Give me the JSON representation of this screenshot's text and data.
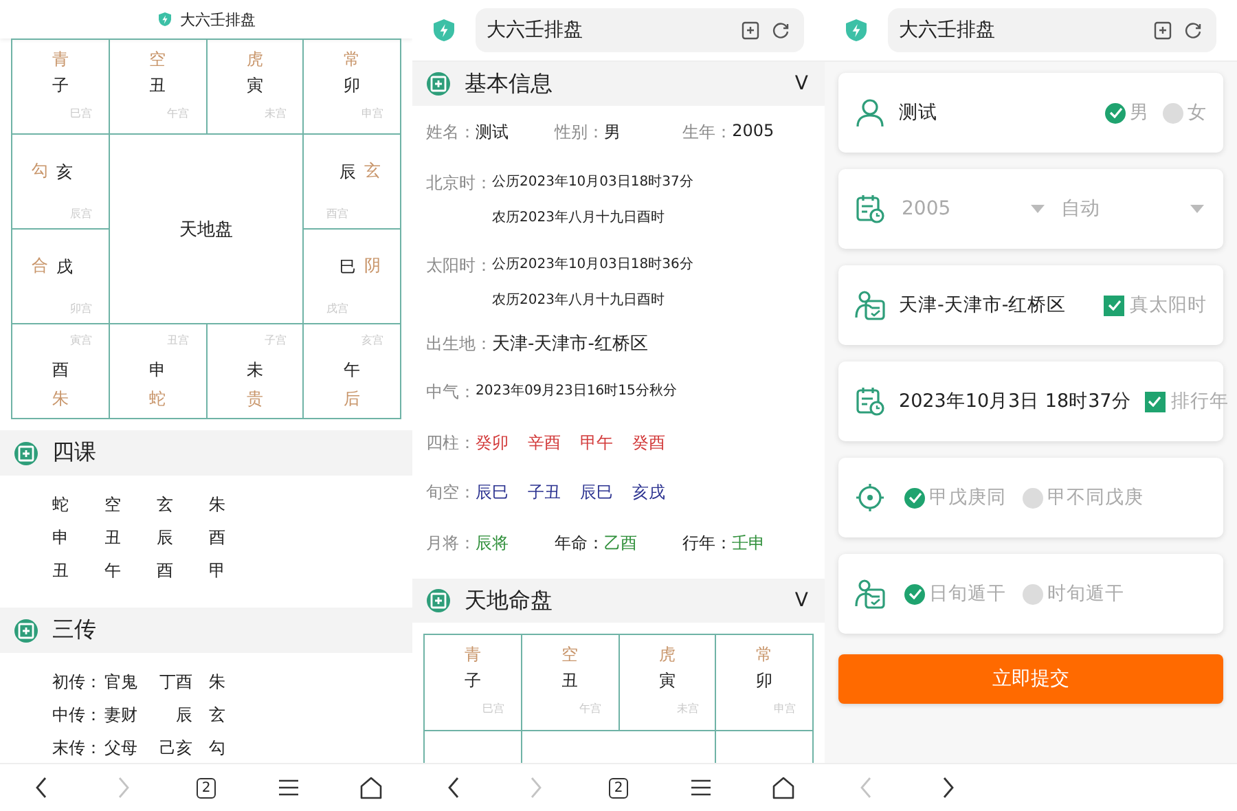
{
  "chart_screen": {
    "title": "大六壬排盘",
    "board": {
      "center": "天地盘",
      "cells": [
        {
          "god": "青",
          "branch": "子",
          "palace": "巳宫"
        },
        {
          "god": "空",
          "branch": "丑",
          "palace": "午宫"
        },
        {
          "god": "虎",
          "branch": "寅",
          "palace": "未宫"
        },
        {
          "god": "常",
          "branch": "卯",
          "palace": "申宫"
        },
        {
          "god": "勾",
          "branch": "亥",
          "palace": "辰宫"
        },
        {
          "god": "玄",
          "branch": "辰",
          "palace": "酉宫"
        },
        {
          "god": "合",
          "branch": "戌",
          "palace": "卯宫"
        },
        {
          "god": "阴",
          "branch": "巳",
          "palace": "戌宫"
        },
        {
          "god": "朱",
          "branch": "酉",
          "palace": "寅宫"
        },
        {
          "god": "蛇",
          "branch": "申",
          "palace": "丑宫"
        },
        {
          "god": "贵",
          "branch": "未",
          "palace": "子宫"
        },
        {
          "god": "后",
          "branch": "午",
          "palace": "亥宫"
        }
      ]
    },
    "lessons": {
      "title": "四课",
      "rows": [
        [
          "蛇",
          "空",
          "玄",
          "朱"
        ],
        [
          "申",
          "丑",
          "辰",
          "酉"
        ],
        [
          "丑",
          "午",
          "酉",
          "甲"
        ]
      ]
    },
    "transmissions": {
      "title": "三传",
      "rows": [
        {
          "label": "初传：",
          "relation": "官鬼",
          "stem_branch": "丁酉",
          "god": "朱"
        },
        {
          "label": "中传：",
          "relation": "妻财",
          "stem_branch": "辰",
          "god": "玄"
        },
        {
          "label": "末传：",
          "relation": "父母",
          "stem_branch": "己亥",
          "god": "勾"
        }
      ]
    },
    "nav": [
      {
        "kind": "back",
        "disabled": false
      },
      {
        "kind": "forward",
        "disabled": true
      },
      {
        "kind": "tabs",
        "label": "2"
      },
      {
        "kind": "menu"
      },
      {
        "kind": "home"
      }
    ]
  },
  "info_screen": {
    "address": "大六壬排盘",
    "basic": {
      "title": "基本信息",
      "toggle": "V",
      "rows": [
        {
          "kind": "fields",
          "fields": [
            {
              "label": "姓名：",
              "value": "测试",
              "strong": false
            },
            {
              "label": "性别：",
              "value": "男",
              "strong": false
            },
            {
              "label": "生年：",
              "value": "2005",
              "strong": false
            }
          ]
        },
        {
          "kind": "lines",
          "label": "北京时：",
          "lines": [
            "公历2023年10月03日18时37分",
            "农历2023年八月十九日酉时"
          ]
        },
        {
          "kind": "lines",
          "label": "太阳时：",
          "lines": [
            "公历2023年10月03日18时36分",
            "农历2023年八月十九日酉时"
          ]
        },
        {
          "kind": "place",
          "label": "出生地：",
          "value": "天津-天津市-红桥区"
        },
        {
          "kind": "lines",
          "label": "中气：",
          "lines": [
            "2023年09月23日16时15分秋分"
          ]
        },
        {
          "kind": "values",
          "label": "四柱：",
          "color": "#d23a3a",
          "values": [
            "癸卯",
            "辛酉",
            "甲午",
            "癸酉"
          ]
        },
        {
          "kind": "values",
          "label": "旬空：",
          "color": "#2b3290",
          "values": [
            "辰巳",
            "子丑",
            "辰巳",
            "亥戌"
          ]
        },
        {
          "kind": "fields",
          "fields": [
            {
              "label": "月将：",
              "value": "辰将",
              "strong": false,
              "color": "#2f8f3a"
            },
            {
              "label": "年命：",
              "value": "乙酉",
              "strong": true,
              "color": "#2f8f3a"
            },
            {
              "label": "行年：",
              "value": "壬申",
              "strong": true,
              "color": "#2f8f3a"
            }
          ]
        }
      ]
    },
    "chart": {
      "title": "天地命盘",
      "toggle": "V",
      "cells": [
        {
          "god": "青",
          "branch": "子",
          "palace": "巳宫"
        },
        {
          "god": "空",
          "branch": "丑",
          "palace": "午宫"
        },
        {
          "god": "虎",
          "branch": "寅",
          "palace": "未宫"
        },
        {
          "god": "常",
          "branch": "卯",
          "palace": "申宫"
        }
      ]
    },
    "nav": [
      {
        "kind": "back",
        "disabled": false
      },
      {
        "kind": "forward",
        "disabled": true
      },
      {
        "kind": "tabs",
        "label": "2"
      },
      {
        "kind": "menu"
      },
      {
        "kind": "home"
      }
    ]
  },
  "form_screen": {
    "address": "大六壬排盘",
    "cards": [
      {
        "kind": "name",
        "value": "测试",
        "options": [
          {
            "label": "男",
            "selected": true
          },
          {
            "label": "女",
            "selected": false
          }
        ]
      },
      {
        "kind": "selects",
        "selects": [
          "2005",
          "自动"
        ]
      },
      {
        "kind": "text_check",
        "value": "天津-天津市-红桥区",
        "check": {
          "label": "真太阳时",
          "checked": true
        }
      },
      {
        "kind": "text_check",
        "value": "2023年10月3日 18时37分",
        "check": {
          "label": "排行年",
          "checked": true
        }
      },
      {
        "kind": "radios",
        "options": [
          {
            "label": "甲戊庚同",
            "selected": true
          },
          {
            "label": "甲不同戊庚",
            "selected": false
          }
        ]
      },
      {
        "kind": "radios",
        "options": [
          {
            "label": "日旬遁干",
            "selected": true
          },
          {
            "label": "时旬遁干",
            "selected": false
          }
        ]
      }
    ],
    "submit": "立即提交",
    "nav": [
      {
        "kind": "back",
        "disabled": true
      },
      {
        "kind": "forward",
        "disabled": false
      }
    ]
  }
}
